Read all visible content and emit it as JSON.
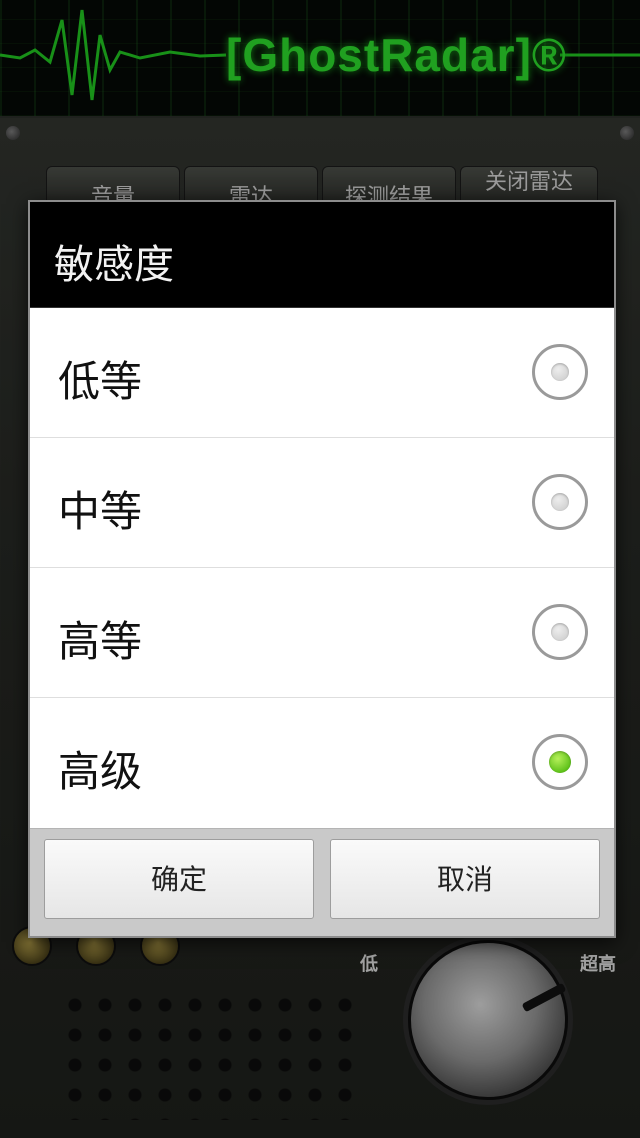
{
  "app": {
    "brand": "[GhostRadar]®",
    "tabs": [
      "音量",
      "雷达",
      "探测结果",
      "关闭雷达"
    ],
    "knob": {
      "low_label": "低",
      "high_label": "超高"
    }
  },
  "dialog": {
    "title": "敏感度",
    "options": [
      {
        "label": "低等",
        "selected": false
      },
      {
        "label": "中等",
        "selected": false
      },
      {
        "label": "高等",
        "selected": false
      },
      {
        "label": "高级",
        "selected": true
      }
    ],
    "confirm_label": "确定",
    "cancel_label": "取消"
  },
  "colors": {
    "accent_green": "#5fc21a",
    "brand_green": "#2bd62b",
    "dialog_header": "#000000"
  }
}
